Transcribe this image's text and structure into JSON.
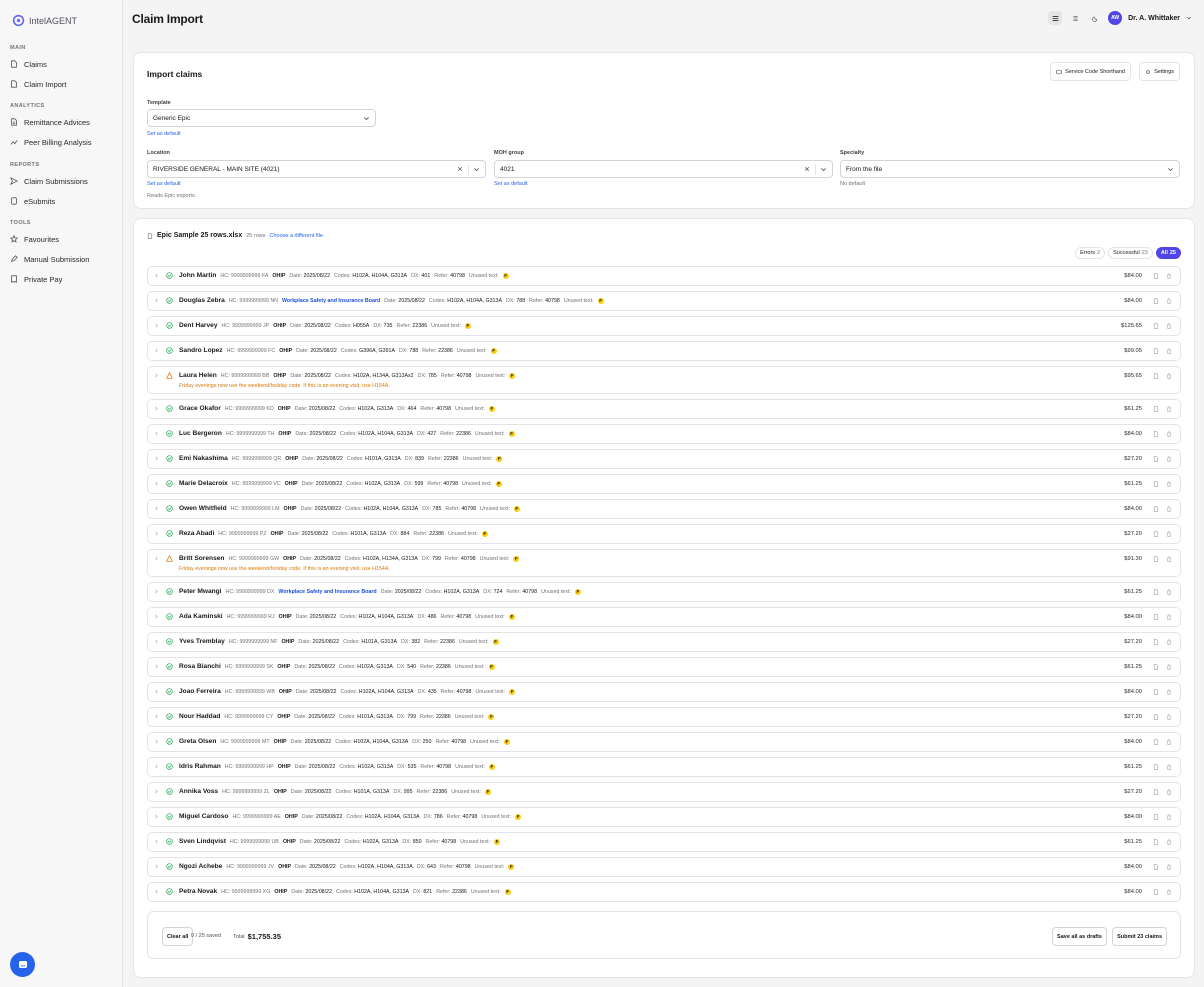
{
  "app": {
    "name": "IntelAGENT"
  },
  "sidebar": {
    "sections": [
      {
        "label": "MAIN",
        "items": [
          {
            "label": "Claims",
            "icon": "file-icon"
          },
          {
            "label": "Claim Import",
            "icon": "file-icon"
          }
        ]
      },
      {
        "label": "ANALYTICS",
        "items": [
          {
            "label": "Remittance Advices",
            "icon": "file-lines-icon"
          },
          {
            "label": "Peer Billing Analysis",
            "icon": "trend-icon"
          }
        ]
      },
      {
        "label": "REPORTS",
        "items": [
          {
            "label": "Claim Submissions",
            "icon": "send-icon"
          },
          {
            "label": "eSubmits",
            "icon": "document-icon"
          }
        ]
      },
      {
        "label": "TOOLS",
        "items": [
          {
            "label": "Favourites",
            "icon": "star-icon"
          },
          {
            "label": "Manual Submission",
            "icon": "pencil-icon"
          },
          {
            "label": "Private Pay",
            "icon": "receipt-icon"
          }
        ]
      }
    ]
  },
  "header": {
    "title": "Claim Import",
    "user": {
      "initials": "AW",
      "name": "Dr. A. Whittaker"
    }
  },
  "import_card": {
    "title": "Import claims",
    "service_code_button": "Service Code Shorthand",
    "settings_button": "Settings",
    "template": {
      "label": "Template",
      "value": "Generic Epic",
      "set_default": "Set as default"
    },
    "location": {
      "label": "Location",
      "value": "RIVERSIDE GENERAL - MAIN SITE (4021)",
      "set_default": "Set as default",
      "note": "Reads Epic exports."
    },
    "moh_group": {
      "label": "MOH group",
      "value": "4021",
      "set_default": "Set as default"
    },
    "specialty": {
      "label": "Specialty",
      "value": "From the file",
      "note": "No default"
    }
  },
  "file": {
    "name": "Epic Sample 25 rows.xlsx",
    "rows": "25 rows",
    "change": "Choose a different file"
  },
  "filters": [
    {
      "label": "Errors",
      "count": "2"
    },
    {
      "label": "Successful",
      "count": "23"
    },
    {
      "label": "All",
      "count": "25"
    }
  ],
  "lbl": {
    "hc": "HC:",
    "date": "Date:",
    "codes": "Codes:",
    "dx": "DX:",
    "refer": "Refer:",
    "unused": "Unused text:",
    "flag": "F"
  },
  "claims": [
    {
      "name": "John Martin",
      "hc": "9999999999 FA",
      "payer": "OHIP",
      "date": "2025/08/22",
      "codes": "H102A, H104A, G313A",
      "dx": "401",
      "refer": "40798",
      "amount": "$84.00",
      "status": "ok"
    },
    {
      "name": "Douglas Zebra",
      "hc": "9999999999 NN",
      "payer": "Workplace Safety and Insurance Board",
      "date": "2025/08/22",
      "codes": "H102A, H104A, G313A",
      "dx": "788",
      "refer": "40798",
      "amount": "$84.00",
      "status": "ok"
    },
    {
      "name": "Dent Harvey",
      "hc": "9999999999 JP",
      "payer": "OHIP",
      "date": "2025/08/22",
      "codes": "H055A",
      "dx": "735",
      "refer": "22386",
      "amount": "$125.65",
      "status": "ok"
    },
    {
      "name": "Sandro Lopez",
      "hc": "9999999999 FC",
      "payer": "OHIP",
      "date": "2025/08/22",
      "codes": "G396A, G391A",
      "dx": "788",
      "refer": "22386",
      "amount": "$99.05",
      "status": "ok"
    },
    {
      "name": "Laura Helen",
      "hc": "9999999999 BB",
      "payer": "OHIP",
      "date": "2025/08/22",
      "codes": "H102A, H134A, G313Ax2",
      "dx": "785",
      "refer": "40798",
      "amount": "$95.65",
      "status": "warn",
      "warning": "Friday evenings now use the weekend/holiday code. If this is an evening visit, use H154A."
    },
    {
      "name": "Grace Okafor",
      "hc": "9999999999 KD",
      "payer": "OHIP",
      "date": "2025/08/22",
      "codes": "H102A, G313A",
      "dx": "464",
      "refer": "40798",
      "amount": "$61.25",
      "status": "ok"
    },
    {
      "name": "Luc Bergeron",
      "hc": "9999999999 TH",
      "payer": "OHIP",
      "date": "2025/08/22",
      "codes": "H102A, H104A, G313A",
      "dx": "427",
      "refer": "22386",
      "amount": "$84.00",
      "status": "ok"
    },
    {
      "name": "Emi Nakashima",
      "hc": "9999999999 QR",
      "payer": "OHIP",
      "date": "2025/08/22",
      "codes": "H101A, G313A",
      "dx": "839",
      "refer": "22386",
      "amount": "$27.20",
      "status": "ok"
    },
    {
      "name": "Marie Delacroix",
      "hc": "9999999999 VC",
      "payer": "OHIP",
      "date": "2025/08/22",
      "codes": "H102A, G313A",
      "dx": "599",
      "refer": "40798",
      "amount": "$61.25",
      "status": "ok"
    },
    {
      "name": "Owen Whitfield",
      "hc": "9999999999 LM",
      "payer": "OHIP",
      "date": "2025/08/22",
      "codes": "H102A, H104A, G313A",
      "dx": "785",
      "refer": "40798",
      "amount": "$84.00",
      "status": "ok"
    },
    {
      "name": "Reza Abadi",
      "hc": "9999999999 PZ",
      "payer": "OHIP",
      "date": "2025/08/22",
      "codes": "H101A, G313A",
      "dx": "884",
      "refer": "22386",
      "amount": "$27.20",
      "status": "ok"
    },
    {
      "name": "Britt Sorensen",
      "hc": "9999999999 GW",
      "payer": "OHIP",
      "date": "2025/08/22",
      "codes": "H102A, H134A, G313A",
      "dx": "799",
      "refer": "40798",
      "amount": "$91.30",
      "status": "warn",
      "warning": "Friday evenings now use the weekend/holiday code. If this is an evening visit, use H154A."
    },
    {
      "name": "Peter Mwangi",
      "hc": "9999999999 DX",
      "payer": "Workplace Safety and Insurance Board",
      "date": "2025/08/22",
      "codes": "H102A, G313A",
      "dx": "724",
      "refer": "40798",
      "amount": "$61.25",
      "status": "ok"
    },
    {
      "name": "Ada Kaminski",
      "hc": "9999999999 RJ",
      "payer": "OHIP",
      "date": "2025/08/22",
      "codes": "H102A, H104A, G313A",
      "dx": "486",
      "refer": "40798",
      "amount": "$84.00",
      "status": "ok"
    },
    {
      "name": "Yves Tremblay",
      "hc": "9999999999 NF",
      "payer": "OHIP",
      "date": "2025/08/22",
      "codes": "H101A, G313A",
      "dx": "382",
      "refer": "22386",
      "amount": "$27.20",
      "status": "ok"
    },
    {
      "name": "Rosa Bianchi",
      "hc": "9999999999 SK",
      "payer": "OHIP",
      "date": "2025/08/22",
      "codes": "H102A, G313A",
      "dx": "540",
      "refer": "22386",
      "amount": "$61.25",
      "status": "ok"
    },
    {
      "name": "Joao Ferreira",
      "hc": "9999999999 WB",
      "payer": "OHIP",
      "date": "2025/08/22",
      "codes": "H102A, H104A, G313A",
      "dx": "435",
      "refer": "40798",
      "amount": "$84.00",
      "status": "ok"
    },
    {
      "name": "Nour Haddad",
      "hc": "9999999999 CY",
      "payer": "OHIP",
      "date": "2025/08/22",
      "codes": "H101A, G313A",
      "dx": "799",
      "refer": "22386",
      "amount": "$27.20",
      "status": "ok"
    },
    {
      "name": "Greta Olsen",
      "hc": "9999999999 MT",
      "payer": "OHIP",
      "date": "2025/08/22",
      "codes": "H102A, H104A, G313A",
      "dx": "250",
      "refer": "40798",
      "amount": "$84.00",
      "status": "ok"
    },
    {
      "name": "Idris Rahman",
      "hc": "9999999999 HP",
      "payer": "OHIP",
      "date": "2025/08/22",
      "codes": "H102A, G313A",
      "dx": "535",
      "refer": "40798",
      "amount": "$61.25",
      "status": "ok"
    },
    {
      "name": "Annika Voss",
      "hc": "9999999999 ZL",
      "payer": "OHIP",
      "date": "2025/08/22",
      "codes": "H101A, G313A",
      "dx": "995",
      "refer": "22386",
      "amount": "$27.20",
      "status": "ok"
    },
    {
      "name": "Miguel Cardoso",
      "hc": "9999999999 AE",
      "payer": "OHIP",
      "date": "2025/08/22",
      "codes": "H102A, H104A, G313A",
      "dx": "786",
      "refer": "40798",
      "amount": "$84.00",
      "status": "ok"
    },
    {
      "name": "Sven Lindqvist",
      "hc": "9999999999 UB",
      "payer": "OHIP",
      "date": "2025/08/22",
      "codes": "H102A, G313A",
      "dx": "850",
      "refer": "40798",
      "amount": "$61.25",
      "status": "ok"
    },
    {
      "name": "Ngozi Achebe",
      "hc": "9999999999 JV",
      "payer": "OHIP",
      "date": "2025/08/22",
      "codes": "H102A, H104A, G313A",
      "dx": "643",
      "refer": "40798",
      "amount": "$84.00",
      "status": "ok"
    },
    {
      "name": "Petra Novak",
      "hc": "9999999999 XG",
      "payer": "OHIP",
      "date": "2025/08/22",
      "codes": "H102A, H104A, G313A",
      "dx": "821",
      "refer": "22386",
      "amount": "$84.00",
      "status": "ok"
    }
  ],
  "footer": {
    "clear": "Clear all",
    "saved": "0 / 25 saved",
    "total_label": "Total",
    "total": "$1,755.35",
    "save_drafts": "Save all as drafts",
    "submit": "Submit 23 claims"
  },
  "colors": {
    "accent": "#4f46e5",
    "ok": "#16a34a",
    "warn": "#d97706",
    "link": "#2563eb",
    "flag": "#facc15"
  }
}
